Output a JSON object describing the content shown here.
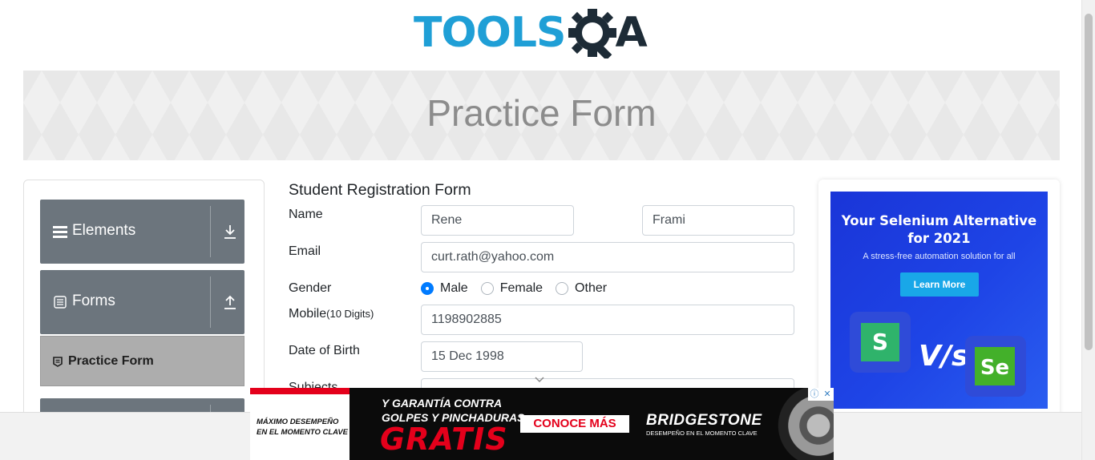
{
  "logo": {
    "tools_text": "TOOLS",
    "a_text": "A"
  },
  "banner": {
    "title": "Practice Form"
  },
  "sidebar": {
    "groups": [
      {
        "label": "Elements",
        "toggle_icon": "download-icon"
      },
      {
        "label": "Forms",
        "toggle_icon": "upload-icon"
      }
    ],
    "active_item": {
      "label": "Practice Form"
    }
  },
  "form": {
    "title": "Student Registration Form",
    "name_label": "Name",
    "first_name": "Rene",
    "last_name": "Frami",
    "email_label": "Email",
    "email": "curt.rath@yahoo.com",
    "gender_label": "Gender",
    "gender_options": [
      "Male",
      "Female",
      "Other"
    ],
    "gender_selected": "Male",
    "mobile_label": "Mobile",
    "mobile_hint": "(10 Digits)",
    "mobile": "1198902885",
    "dob_label": "Date of Birth",
    "dob": "15 Dec 1998",
    "subjects_label": "Subjects"
  },
  "side_ad": {
    "title_line1": "Your Selenium Alternative",
    "title_line2": "for 2021",
    "subtitle": "A stress-free automation solution for all",
    "button": "Learn More",
    "vs": "V/s",
    "logo_left": "S",
    "logo_right": "Se"
  },
  "bottom_ad": {
    "left_line1": "MÁXIMO DESEMPEÑO",
    "left_line2": "EN EL MOMENTO CLAVE",
    "line1": "Y GARANTÍA CONTRA",
    "line2": "GOLPES Y PINCHADURAS",
    "gratis": "GRATIS",
    "cta": "CONOCE MÁS",
    "brand": "BRIDGESTONE",
    "tagline": "DESEMPEÑO EN EL MOMENTO CLAVE"
  },
  "colors": {
    "accent_blue": "#007bff",
    "sidebar_gray": "#6c757d",
    "tools_blue": "#1f9fd6",
    "ad_red": "#e4001b"
  }
}
